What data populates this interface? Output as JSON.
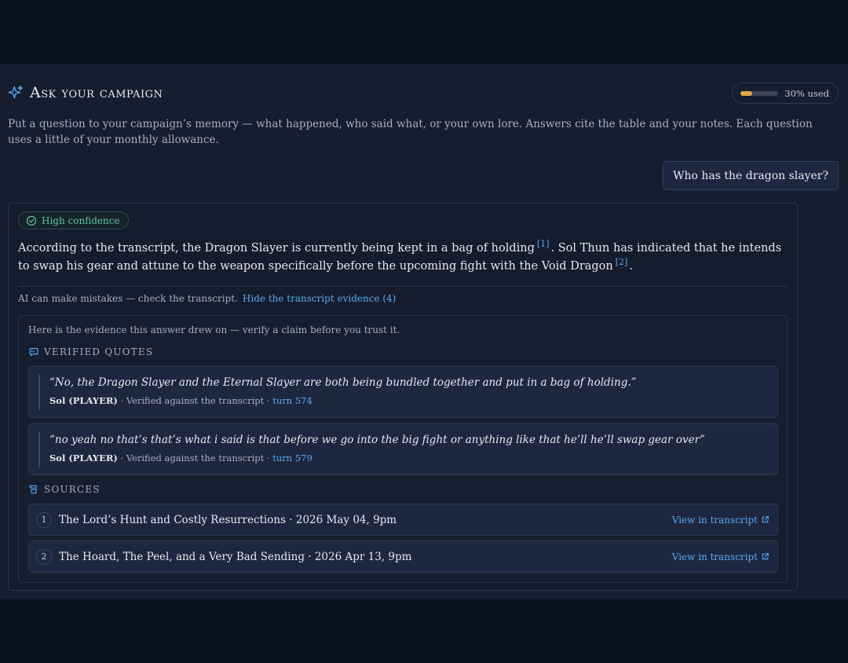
{
  "header": {
    "title": "Ask your campaign",
    "usage_text": "30% used",
    "usage_fraction": 0.3
  },
  "intro": "Put a question to your campaign’s memory — what happened, who said what, or your own lore. Answers cite the table and your notes. Each question uses a little of your monthly allowance.",
  "question": "Who has the dragon slayer?",
  "answer": {
    "confidence": "High confidence",
    "text_part1": "According to the transcript, the Dragon Slayer is currently being kept in a bag of holding",
    "cite1": "[1]",
    "text_part2": ". Sol Thun has indicated that he intends to swap his gear and attune to the weapon specifically before the upcoming fight with the Void Dragon",
    "cite2": "[2]",
    "text_part3": ".",
    "disclaimer": "AI can make mistakes — check the transcript.",
    "hide_link": "Hide the transcript evidence (4)"
  },
  "evidence": {
    "intro": "Here is the evidence this answer drew on — verify a claim before you trust it.",
    "quotes_label": "Verified quotes",
    "quotes": [
      {
        "text": "“No, the Dragon Slayer and the Eternal Slayer are both being bundled together and put in a bag of holding.”",
        "speaker": "Sol (PLAYER)",
        "verified": " · Verified against the transcript · ",
        "turn": "turn 574"
      },
      {
        "text": "“no yeah no that’s that’s what i said is that before we go into the big fight or anything like that he’ll he’ll swap gear over”",
        "speaker": "Sol (PLAYER)",
        "verified": " · Verified against the transcript · ",
        "turn": "turn 579"
      }
    ],
    "sources_label": "Sources",
    "sources": [
      {
        "num": "1",
        "title": "The Lord’s Hunt and Costly Resurrections · 2026 May 04, 9pm",
        "link": "View in transcript"
      },
      {
        "num": "2",
        "title": "The Hoard, The Peel, and a Very Bad Sending · 2026 Apr 13, 9pm",
        "link": "View in transcript"
      }
    ]
  },
  "colors": {
    "accent": "#5aa8f0",
    "confidence": "#5cc4a2",
    "usage_fill": "#e2a74a"
  }
}
